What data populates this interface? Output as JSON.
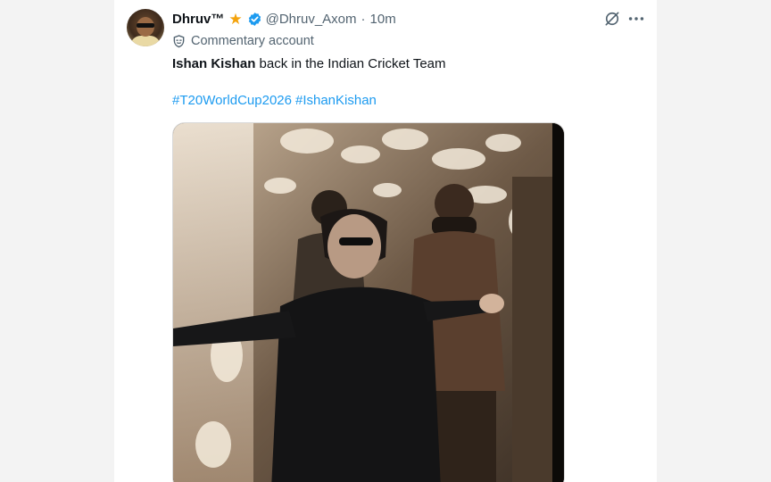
{
  "tweet": {
    "display_name": "Dhruv™",
    "handle": "@Dhruv_Axom",
    "separator": "·",
    "time": "10m",
    "commentary_label": "Commentary account",
    "text_bold": "Ishan Kishan",
    "text_rest": " back in the Indian Cricket Team",
    "hashtags": [
      "#T20WorldCup2026",
      "#IshanKishan"
    ]
  },
  "icons": {
    "badge_star": "star-icon",
    "verified": "verified-badge-icon",
    "grok": "grok-icon",
    "more": "more-icon",
    "commentary": "shield-icon"
  },
  "colors": {
    "link": "#1d9bf0",
    "verified": "#1d9bf0",
    "star": "#f4a30c",
    "muted_text": "#536471"
  }
}
